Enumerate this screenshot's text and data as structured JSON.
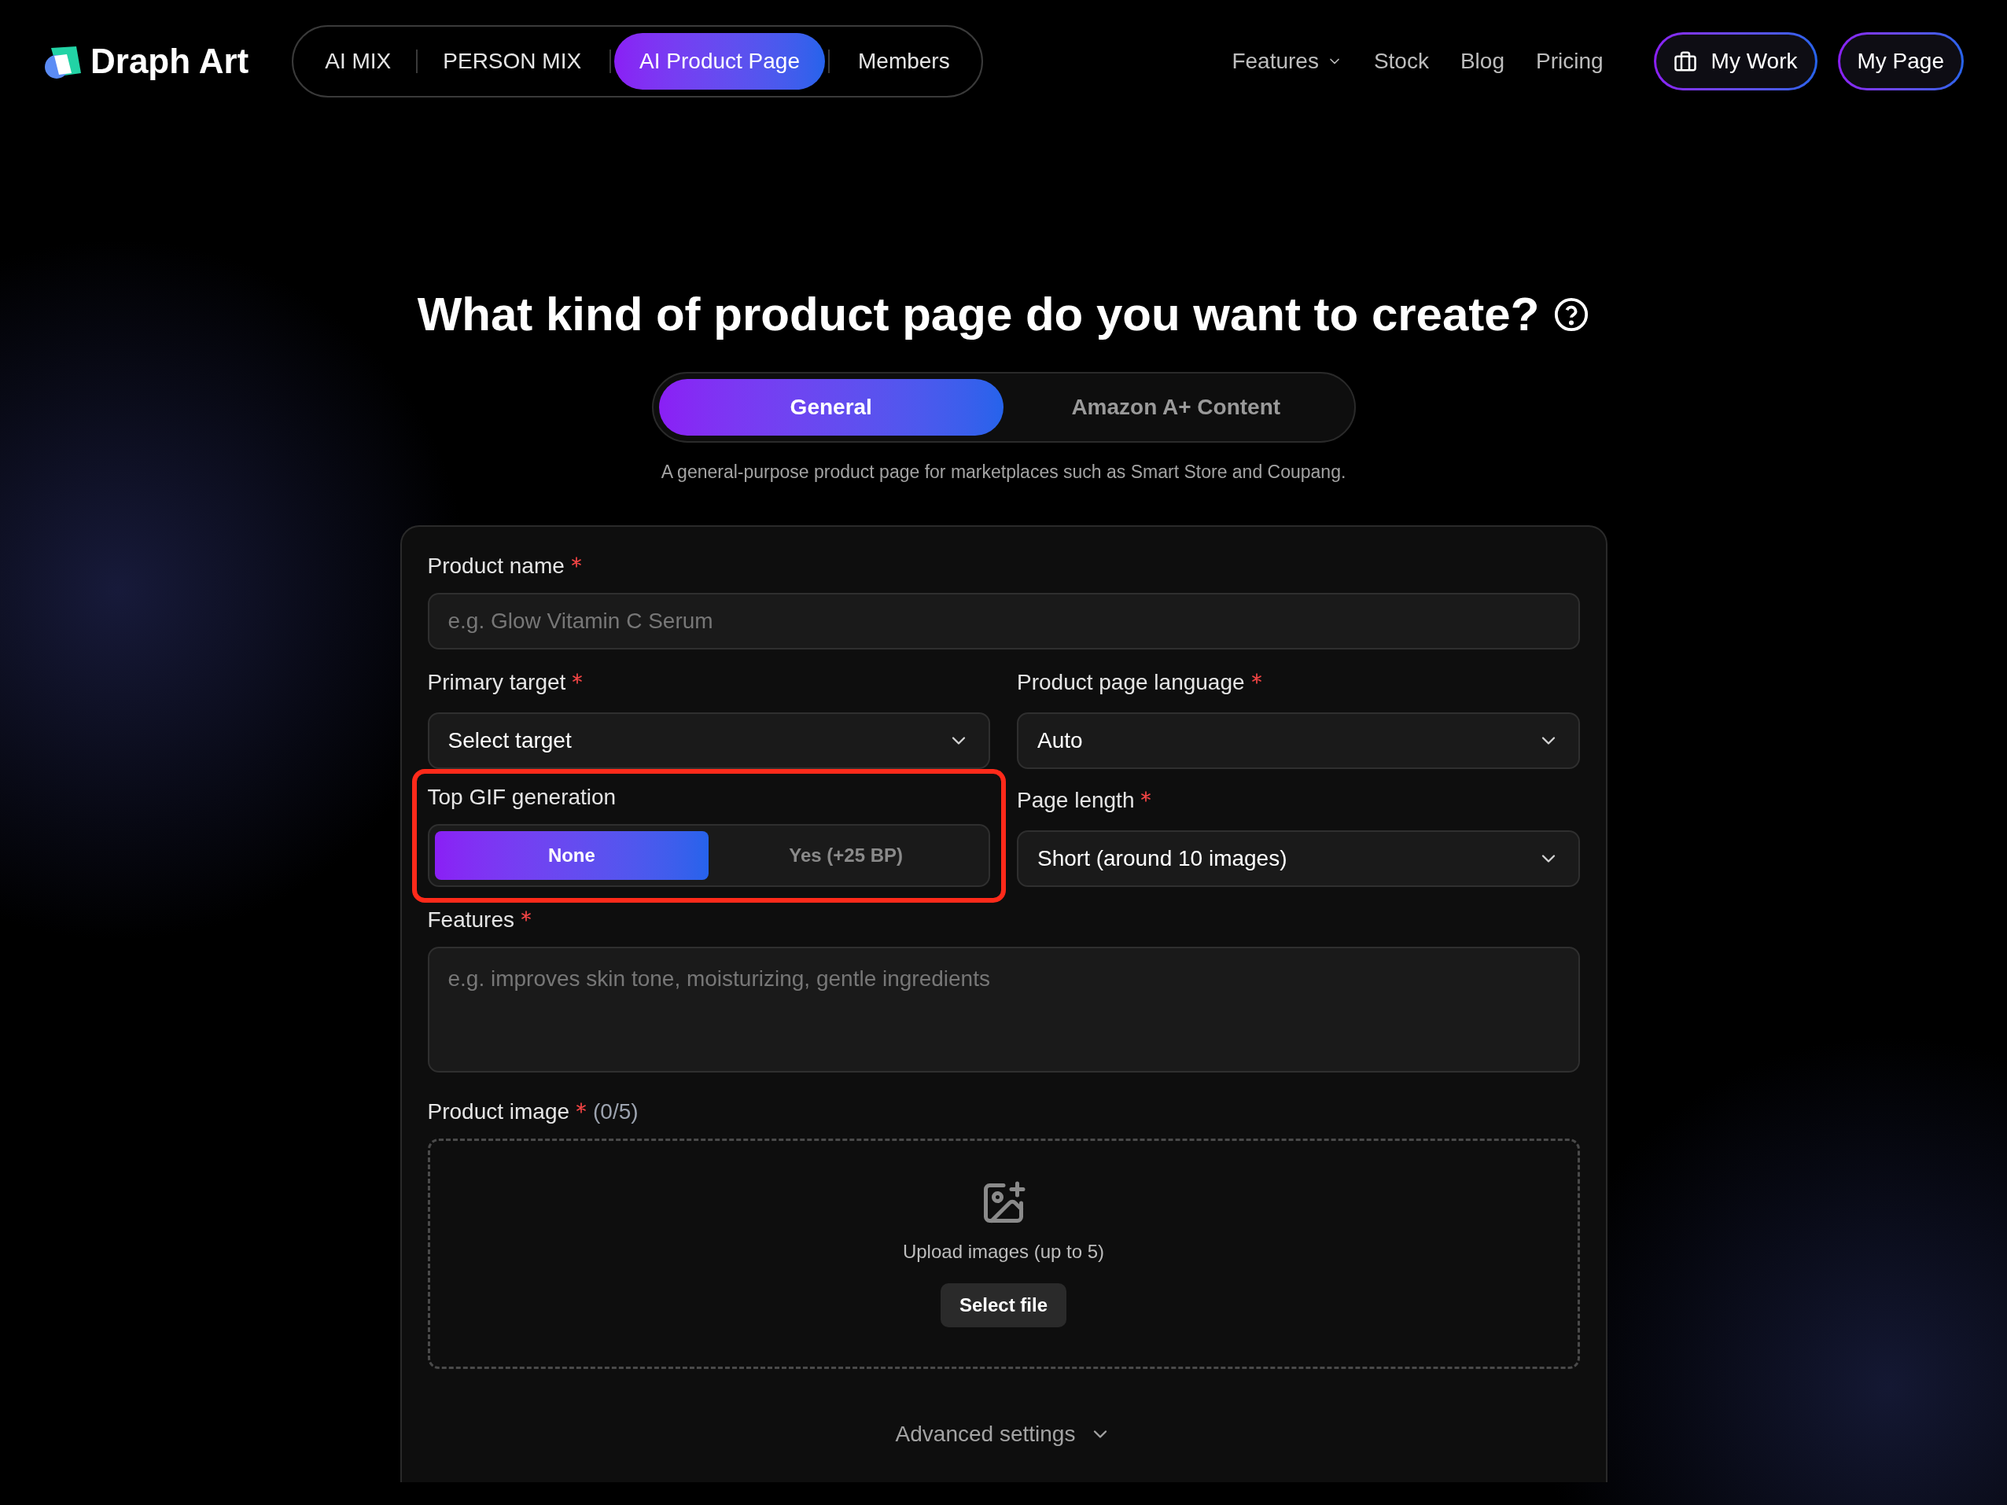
{
  "header": {
    "logo": "Draph Art",
    "nav": [
      {
        "label": "AI MIX",
        "selected": false
      },
      {
        "label": "PERSON MIX",
        "selected": false
      },
      {
        "label": "AI Product Page",
        "selected": true
      },
      {
        "label": "Members",
        "selected": false
      }
    ],
    "links": [
      {
        "label": "Features",
        "kind": "dropdown"
      },
      {
        "label": "Stock",
        "kind": "link"
      },
      {
        "label": "Blog",
        "kind": "link"
      },
      {
        "label": "Pricing",
        "kind": "link"
      }
    ],
    "buttons": [
      {
        "label": "My Work",
        "kind": "icon"
      },
      {
        "label": "My Page",
        "kind": "plain"
      }
    ]
  },
  "title": "What kind of product page do you want to create?",
  "types": [
    {
      "label": "General",
      "selected": true
    },
    {
      "label": "Amazon A+ Content",
      "selected": false
    }
  ],
  "description": "A general-purpose product page for marketplaces such as Smart Store and Coupang.",
  "form": {
    "product_name": {
      "label": "Product name",
      "required": true,
      "placeholder": "e.g. Glow Vitamin C Serum"
    },
    "primary_target": {
      "label": "Primary target",
      "required": true,
      "value": "Select target"
    },
    "language": {
      "label": "Product page language",
      "required": true,
      "value": "Auto"
    },
    "gif": {
      "label": "Top GIF generation",
      "highlighted": true,
      "options": [
        {
          "label": "None",
          "selected": true
        },
        {
          "label": "Yes (+25 BP)",
          "selected": false
        }
      ]
    },
    "page_length": {
      "label": "Page length",
      "required": true,
      "value": "Short (around 10 images)"
    },
    "features": {
      "label": "Features",
      "required": true,
      "placeholder": "e.g. improves skin tone, moisturizing, gentle ingredients"
    },
    "product_image": {
      "label": "Product image",
      "required": true,
      "count": "(0/5)",
      "hint": "Upload images (up to 5)",
      "button": "Select file"
    },
    "advanced": "Advanced settings"
  }
}
